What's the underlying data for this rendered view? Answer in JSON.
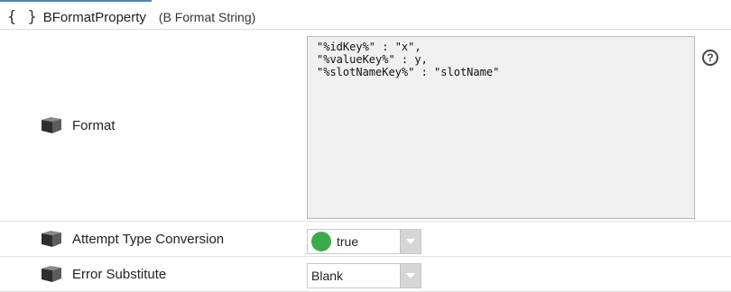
{
  "header": {
    "icon": "braces-icon",
    "icon_glyph": "{ }",
    "property_name": "BFormatProperty",
    "property_type": "(B Format String)"
  },
  "rows": {
    "format": {
      "label": "Format",
      "value": "\"%idKey%\" : \"x\",\n\"%valueKey%\" : y,\n\"%slotNameKey%\" : \"slotName\"",
      "help_glyph": "?"
    },
    "attempt_type_conversion": {
      "label": "Attempt Type Conversion",
      "value": "true",
      "status_color": "#3cab4a"
    },
    "error_substitute": {
      "label": "Error Substitute",
      "value": "Blank"
    }
  },
  "colors": {
    "accent": "#4a86c5",
    "true_status": "#3cab4a"
  }
}
